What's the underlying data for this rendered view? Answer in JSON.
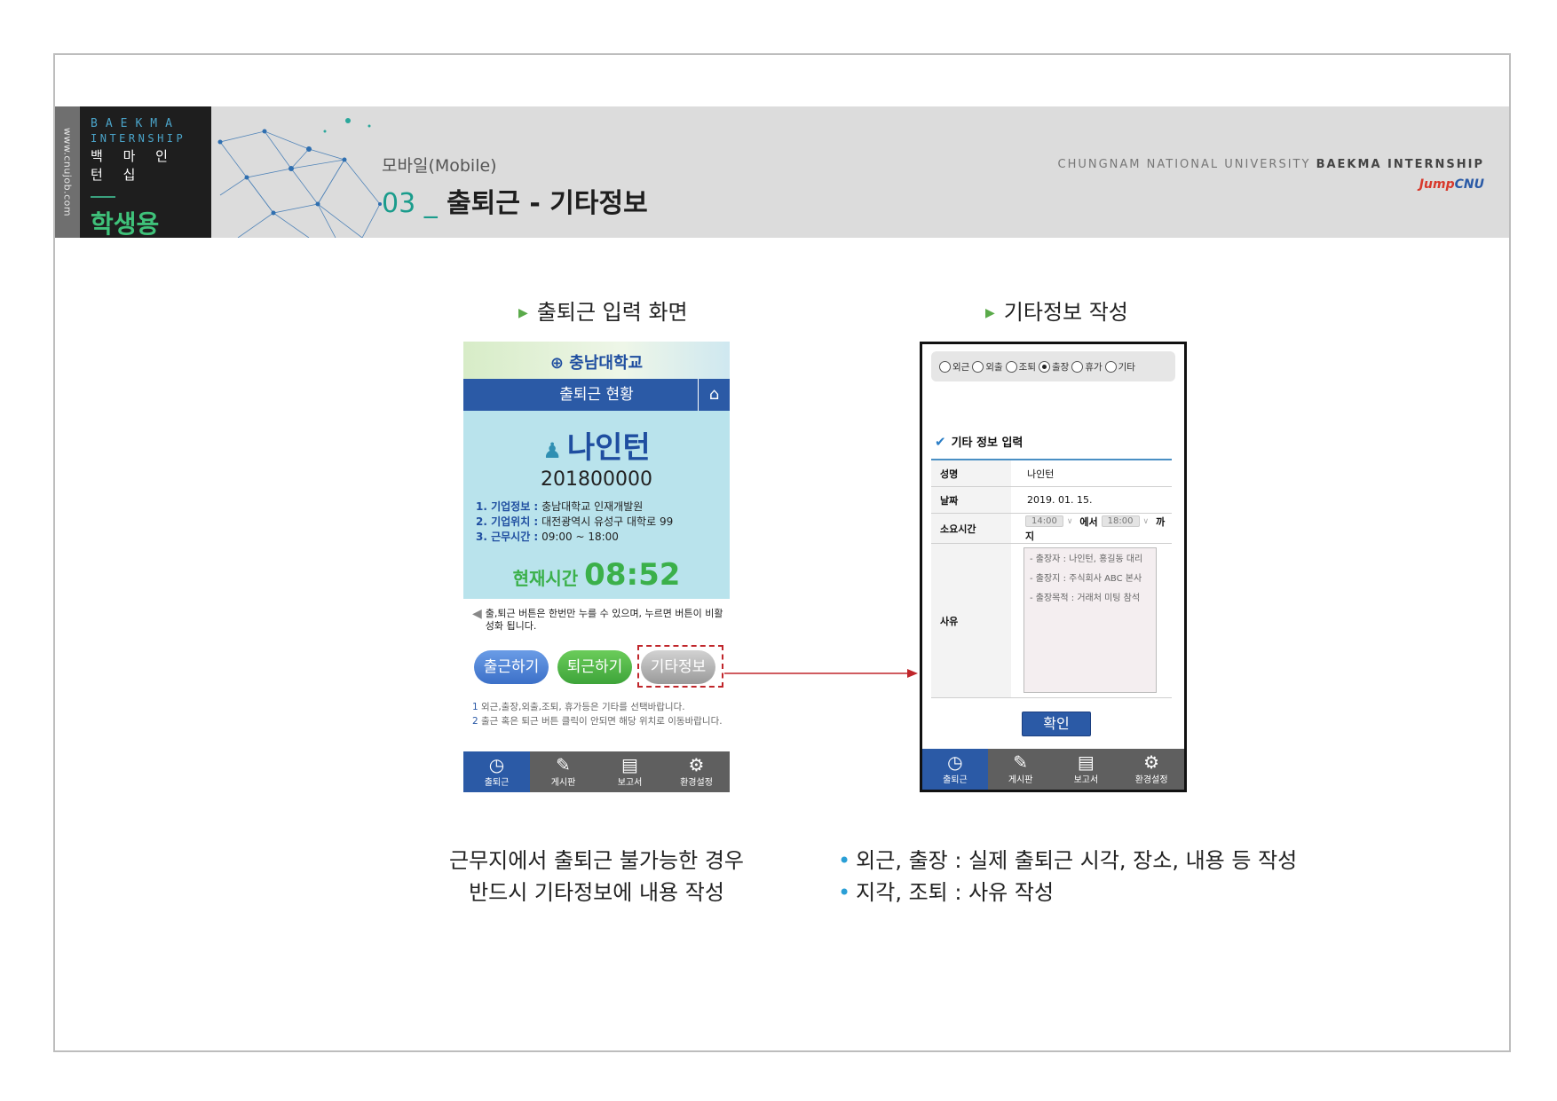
{
  "header": {
    "url": "www.cnujob.com",
    "logo_line1": "BAEKMA",
    "logo_line2": "INTERNSHIP",
    "logo_line3": "백 마 인 턴 십",
    "logo_student": "학생용",
    "subtitle": "모바일(Mobile)",
    "title_num": "03 _",
    "title_text": " 출퇴근 - 기타정보",
    "univ_light": "CHUNGNAM NATIONAL UNIVERSITY ",
    "univ_bold": "BAEKMA INTERNSHIP",
    "jump": "Jump",
    "cnu": "CNU"
  },
  "left_caption": "출퇴근 입력 화면",
  "right_caption": "기타정보 작성",
  "phone1": {
    "logo": "충남대학교",
    "bar_title": "출퇴근 현황",
    "name": "나인턴",
    "id": "201800000",
    "info": [
      {
        "k": "1. 기업정보 :",
        "v": "충남대학교 인재개발원"
      },
      {
        "k": "2. 기업위치 :",
        "v": "대전광역시 유성구 대학로 99"
      },
      {
        "k": "3. 근무시간 :",
        "v": "09:00 ~ 18:00"
      }
    ],
    "time_label": "현재시간",
    "time_value": "08:52",
    "note": "출,퇴근 버튼은 한번만 누를 수 있으며, 누르면 버튼이 비활성화 됩니다.",
    "btn_in": "출근하기",
    "btn_out": "퇴근하기",
    "btn_etc": "기타정보",
    "foot1_n": "1",
    "foot1": " 외근,출장,외출,조퇴, 휴가등은 기타를 선택바랍니다.",
    "foot2_n": "2",
    "foot2": " 출근 혹은 퇴근 버튼 클릭이 안되면 해당 위치로 이동바랍니다."
  },
  "tabs": {
    "t1": "출퇴근",
    "t2": "게시판",
    "t3": "보고서",
    "t4": "환경설정"
  },
  "phone2": {
    "radios": [
      "외근",
      "외출",
      "조퇴",
      "출장",
      "휴가",
      "기타"
    ],
    "selected": "출장",
    "section": "기타 정보 입력",
    "name_k": "성명",
    "name_v": "나인턴",
    "date_k": "날짜",
    "date_v": "2019. 01. 15.",
    "dur_k": "소요시간",
    "from": "14:00",
    "mid": "에서",
    "to": "18:00",
    "end1": "까",
    "end2": "지",
    "reason_k": "사유",
    "reason_lines": [
      "- 출장자 : 나인턴, 홍길동 대리",
      "- 출장지 : 주식회사 ABC 본사",
      "- 출장목적 : 거래처 미팅 참석"
    ],
    "confirm": "확인"
  },
  "left_desc_1": "근무지에서 출퇴근 불가능한 경우",
  "left_desc_2": "반드시 기타정보에 내용 작성",
  "right_desc_1": "외근, 출장 : 실제 출퇴근 시각, 장소, 내용 등 작성",
  "right_desc_2": "지각, 조퇴 : 사유 작성",
  "colors": {
    "accent_blue": "#2b5aa6",
    "accent_green": "#3bb04a",
    "highlight_red": "#c0262b"
  }
}
